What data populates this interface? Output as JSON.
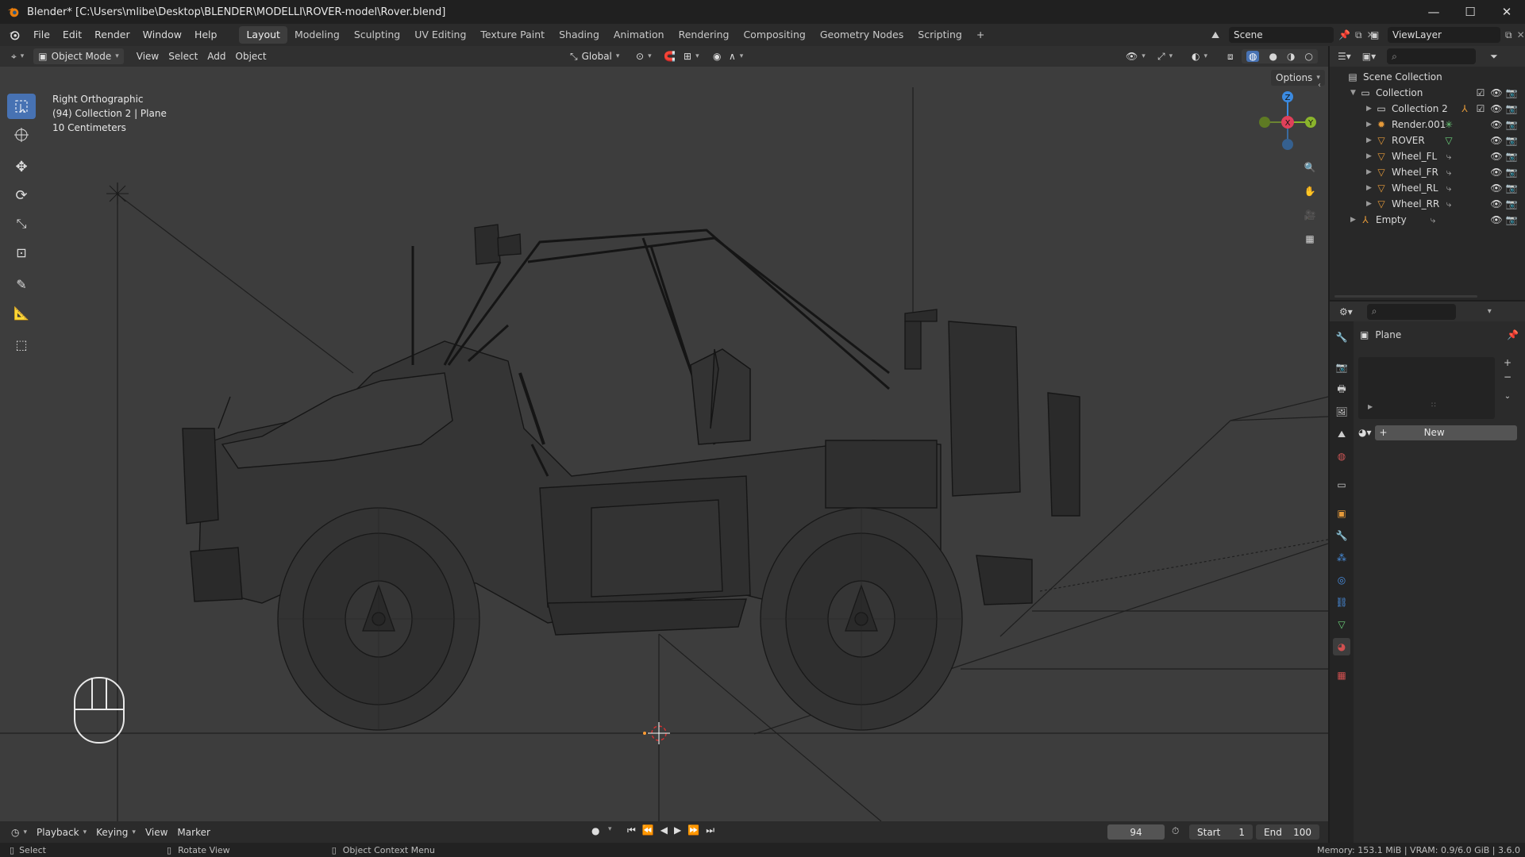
{
  "title_bar": {
    "title": "Blender* [C:\\Users\\mlibe\\Desktop\\BLENDER\\MODELLI\\ROVER-model\\Rover.blend]",
    "minimize": "—",
    "maximize": "☐",
    "close": "✕"
  },
  "menu": [
    "File",
    "Edit",
    "Render",
    "Window",
    "Help"
  ],
  "workspaces": [
    "Layout",
    "Modeling",
    "Sculpting",
    "UV Editing",
    "Texture Paint",
    "Shading",
    "Animation",
    "Rendering",
    "Compositing",
    "Geometry Nodes",
    "Scripting"
  ],
  "workspace_add": "+",
  "scene": {
    "name": "Scene"
  },
  "view_layer": {
    "name": "ViewLayer"
  },
  "viewport_header": {
    "mode": "Object Mode",
    "menus": [
      "View",
      "Select",
      "Add",
      "Object"
    ],
    "transform_orientation": "Global",
    "options": "Options"
  },
  "viewport_overlay": {
    "view_name": "Right Orthographic",
    "collection_info": "(94) Collection 2 | Plane",
    "scale": "10 Centimeters"
  },
  "gizmo": {
    "z": "Z",
    "y": "Y",
    "x": "X"
  },
  "outliner": {
    "root": "Scene Collection",
    "items": [
      {
        "label": "Collection",
        "level": 0
      },
      {
        "label": "Collection 2",
        "level": 1
      },
      {
        "label": "Render.001",
        "level": 1
      },
      {
        "label": "ROVER",
        "level": 1
      },
      {
        "label": "Wheel_FL",
        "level": 1
      },
      {
        "label": "Wheel_FR",
        "level": 1
      },
      {
        "label": "Wheel_RL",
        "level": 1
      },
      {
        "label": "Wheel_RR",
        "level": 1
      },
      {
        "label": "Empty",
        "level": 0
      }
    ]
  },
  "properties": {
    "object_name": "Plane",
    "new_button": "New"
  },
  "timeline": {
    "menus": [
      "Playback",
      "Keying",
      "View",
      "Marker"
    ],
    "current_frame": "94",
    "start_label": "Start",
    "start_value": "1",
    "end_label": "End",
    "end_value": "100"
  },
  "status_bar": {
    "select": "Select",
    "rotate": "Rotate View",
    "context_menu": "Object Context Menu",
    "memory": "Memory: 153.1 MiB | VRAM: 0.9/6.0 GiB | 3.6.0"
  },
  "colors": {
    "accent": "#4772b3",
    "viewport_bg": "#3d3d3d",
    "x_axis": "#e0405a",
    "y_axis": "#8ab42c",
    "z_axis": "#3b8ae0"
  }
}
